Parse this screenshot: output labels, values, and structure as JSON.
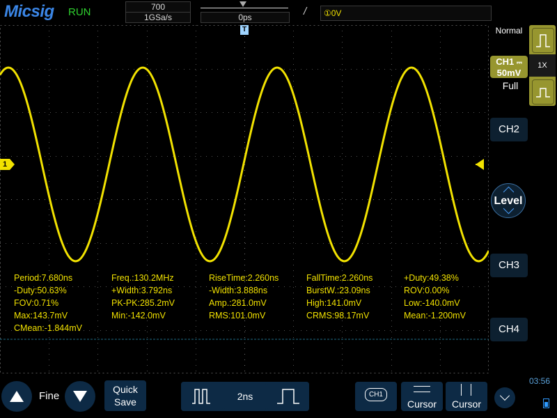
{
  "header": {
    "brand": "Micsig",
    "run_status": "RUN",
    "memory_depth": "700",
    "sample_rate": "1GSa/s",
    "horizontal_position": "0ps",
    "trigger_info": "①0V"
  },
  "right_panel": {
    "acquisition_mode": "Normal",
    "ch1_label": "CH1",
    "ch1_scale": "50mV",
    "probe_mult": "1X",
    "bandwidth": "Full",
    "ch2_label": "CH2",
    "ch3_label": "CH3",
    "ch4_label": "CH4",
    "level_label": "Level"
  },
  "screen": {
    "trigger_time_marker": "T",
    "ch1_ground_marker": "1",
    "waveform_color": "#f2e200",
    "measurements": [
      "Period:7.680ns",
      "Freq.:130.2MHz",
      "RiseTime:2.260ns",
      "FallTime:2.260ns",
      "+Duty:49.38%",
      "-Duty:50.63%",
      "+Width:3.792ns",
      "-Width:3.888ns",
      "BurstW.:23.09ns",
      "ROV:0.00%",
      "FOV:0.71%",
      "PK-PK:285.2mV",
      "Amp.:281.0mV",
      "High:141.0mV",
      "Low:-140.0mV",
      "Max:143.7mV",
      "Min:-142.0mV",
      "RMS:101.0mV",
      "CRMS:98.17mV",
      "Mean:-1.200mV",
      "CMean:-1.844mV"
    ]
  },
  "bottom_bar": {
    "fine_label": "Fine",
    "quick_label": "Quick",
    "save_label": "Save",
    "timebase": "2ns",
    "ch1_badge": "CH1",
    "cursor_h_label": "Cursor",
    "cursor_v_label": "Cursor",
    "clock": "03:56"
  }
}
